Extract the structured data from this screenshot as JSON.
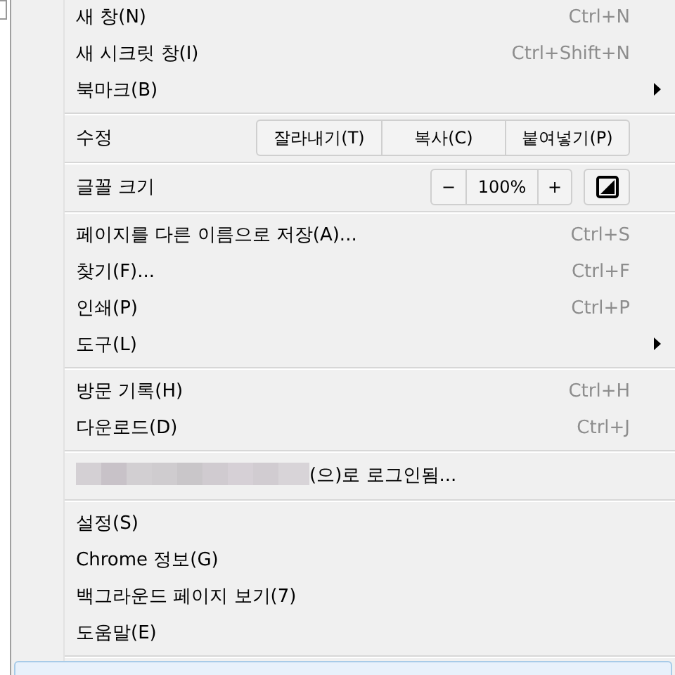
{
  "menu": {
    "entries": [
      {
        "kind": "item",
        "label": "새 창(N)",
        "shortcut": "Ctrl+N",
        "submenu": false
      },
      {
        "kind": "item",
        "label": "새 시크릿 창(I)",
        "shortcut": "Ctrl+Shift+N",
        "submenu": false
      },
      {
        "kind": "item",
        "label": "북마크(B)",
        "submenu": true
      },
      {
        "kind": "separator"
      },
      {
        "kind": "edit",
        "label": "수정",
        "buttons": [
          "잘라내기(T)",
          "복사(C)",
          "붙여넣기(P)"
        ]
      },
      {
        "kind": "separator"
      },
      {
        "kind": "zoom",
        "label": "글꼴 크기",
        "minus": "−",
        "value": "100%",
        "plus": "+"
      },
      {
        "kind": "separator"
      },
      {
        "kind": "item",
        "label": "페이지를 다른 이름으로 저장(A)...",
        "shortcut": "Ctrl+S",
        "submenu": false
      },
      {
        "kind": "item",
        "label": "찾기(F)...",
        "shortcut": "Ctrl+F",
        "submenu": false
      },
      {
        "kind": "item",
        "label": "인쇄(P)",
        "shortcut": "Ctrl+P",
        "submenu": false
      },
      {
        "kind": "item",
        "label": "도구(L)",
        "submenu": true
      },
      {
        "kind": "separator"
      },
      {
        "kind": "item",
        "label": "방문 기록(H)",
        "shortcut": "Ctrl+H",
        "submenu": false
      },
      {
        "kind": "item",
        "label": "다운로드(D)",
        "shortcut": "Ctrl+J",
        "submenu": false
      },
      {
        "kind": "separator"
      },
      {
        "kind": "account",
        "label": "(으)로 로그인됨..."
      },
      {
        "kind": "separator"
      },
      {
        "kind": "item",
        "label": "설정(S)",
        "submenu": false
      },
      {
        "kind": "item",
        "label": "Chrome 정보(G)",
        "submenu": false
      },
      {
        "kind": "item",
        "label": "백그라운드 페이지 보기(7)",
        "submenu": false
      },
      {
        "kind": "item",
        "label": "도움말(E)",
        "submenu": false
      },
      {
        "kind": "separator"
      }
    ]
  }
}
